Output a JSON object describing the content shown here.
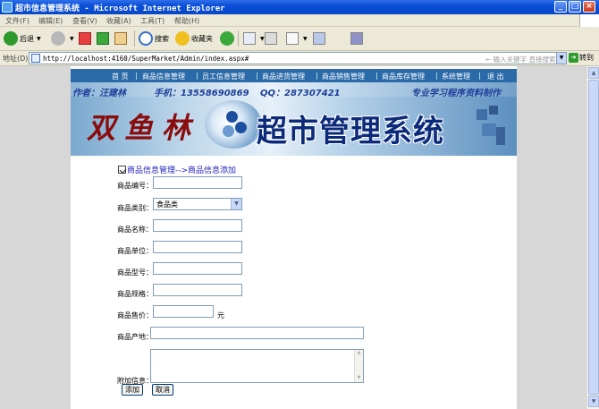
{
  "window": {
    "title": "超市信息管理系统 - Microsoft Internet Explorer",
    "minimize": "_",
    "maximize": "□",
    "close": "×"
  },
  "menu": [
    "文件(F)",
    "编辑(E)",
    "查看(V)",
    "收藏(A)",
    "工具(T)",
    "帮助(H)"
  ],
  "toolbar": {
    "back": "后退",
    "search": "搜索",
    "favorites": "收藏夹"
  },
  "address": {
    "label": "地址(D)",
    "url": "http://localhost:4160/SuperMarket/Admin/index.aspx#",
    "search_hint": "← 输入关键字 直接搜索",
    "go": "转到"
  },
  "nav": {
    "items": [
      "首 页",
      "商品信息管理",
      "员工信息管理",
      "商品进货管理",
      "商品销售管理",
      "商品库存管理",
      "系统管理",
      "退 出"
    ]
  },
  "banner": {
    "author": "作者：汪建林",
    "phone": "手机：13558690869",
    "qq": "QQ：287307421",
    "slogan": "专业学习程序资料制作",
    "brand": "双鱼林",
    "system_name": "超市管理系统"
  },
  "form": {
    "breadcrumb": "商品信息管理-->商品信息添加",
    "fields": {
      "code_label": "商品编号：",
      "category_label": "商品类别：",
      "category_value": "食品类",
      "name_label": "商品名称：",
      "unit_label": "商品单位：",
      "model_label": "商品型号：",
      "spec_label": "商品规格：",
      "price_label": "商品售价：",
      "price_unit": "元",
      "origin_label": "商品产地：",
      "extra_label": "附加信息："
    },
    "add_button": "添加",
    "cancel_button": "取消"
  }
}
